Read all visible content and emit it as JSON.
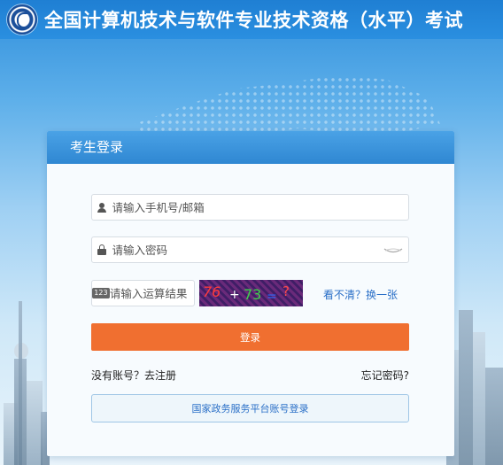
{
  "header": {
    "title": "全国计算机技术与软件专业技术资格（水平）考试",
    "logo_icon": "exam-emblem-logo"
  },
  "login": {
    "card_title": "考生登录",
    "username_placeholder": "请输入手机号/邮箱",
    "password_placeholder": "请输入密码",
    "captcha_placeholder": "请输入运算结果",
    "captcha_text": "76 + 73 = ?",
    "captcha_icon_label": "123",
    "refresh_label": "看不清？换一张",
    "login_button": "登录",
    "register_link": "没有账号？去注册",
    "forgot_link": "忘记密码?",
    "gov_login_button": "国家政务服务平台账号登录"
  },
  "colors": {
    "header_bg": "#2a8fe0",
    "card_head_bg": "#3a93da",
    "login_button_bg": "#f06f30",
    "link_color": "#2a6fc7"
  }
}
